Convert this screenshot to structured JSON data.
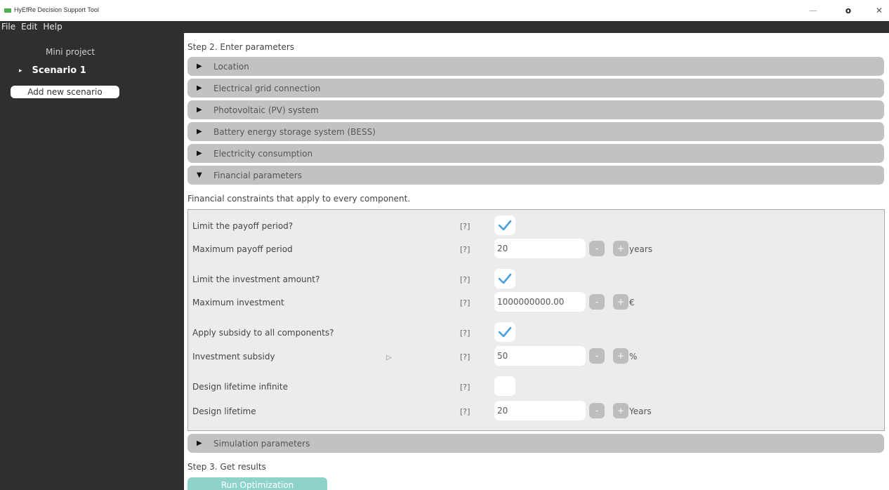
{
  "window": {
    "title": "HyEfRe Decision Support Tool",
    "min_glyph": "—",
    "max_glyph": "o",
    "close_glyph": "✕"
  },
  "menu": [
    "File",
    "Edit",
    "Help"
  ],
  "sidebar": {
    "project": "Mini project",
    "scenario_arrow": "▸",
    "scenario": "Scenario 1",
    "add_scenario": "Add new scenario"
  },
  "step2": {
    "title": "Step 2. Enter parameters"
  },
  "sections": [
    {
      "label": "Location",
      "arrow": "▶"
    },
    {
      "label": "Electrical grid connection",
      "arrow": "▶"
    },
    {
      "label": "Photovoltaic (PV) system",
      "arrow": "▶"
    },
    {
      "label": "Battery energy storage system (BESS)",
      "arrow": "▶"
    },
    {
      "label": "Electricity consumption",
      "arrow": "▶"
    },
    {
      "label": "Financial parameters",
      "arrow": "▼"
    }
  ],
  "financial": {
    "description": "Financial constraints that apply to every component.",
    "help": "[?]",
    "minus": "-",
    "plus": "+",
    "cursor_glyph": "▷",
    "limit_payoff": {
      "label": "Limit the payoff period?",
      "checked": true
    },
    "max_payoff": {
      "label": "Maximum payoff period",
      "value": "20",
      "unit": "years"
    },
    "limit_investment": {
      "label": "Limit the investment amount?",
      "checked": true
    },
    "max_investment": {
      "label": "Maximum investment",
      "value": "1000000000.00",
      "unit": "€"
    },
    "apply_subsidy": {
      "label": "Apply subsidy to all components?",
      "checked": true
    },
    "subsidy": {
      "label": "Investment subsidy",
      "value": "50",
      "unit": "%"
    },
    "lifetime_infinite": {
      "label": "Design lifetime infinite",
      "checked": false
    },
    "lifetime": {
      "label": "Design lifetime",
      "value": "20",
      "unit": "Years"
    }
  },
  "simulation": {
    "label": "Simulation parameters",
    "arrow": "▶"
  },
  "step3": {
    "title": "Step 3. Get results",
    "run_label": "Run Optimization"
  },
  "colors": {
    "check": "#4a9fe0",
    "accent": "#8ed3cb",
    "section": "#c2c2c2",
    "sidebar": "#2f2f2f"
  }
}
